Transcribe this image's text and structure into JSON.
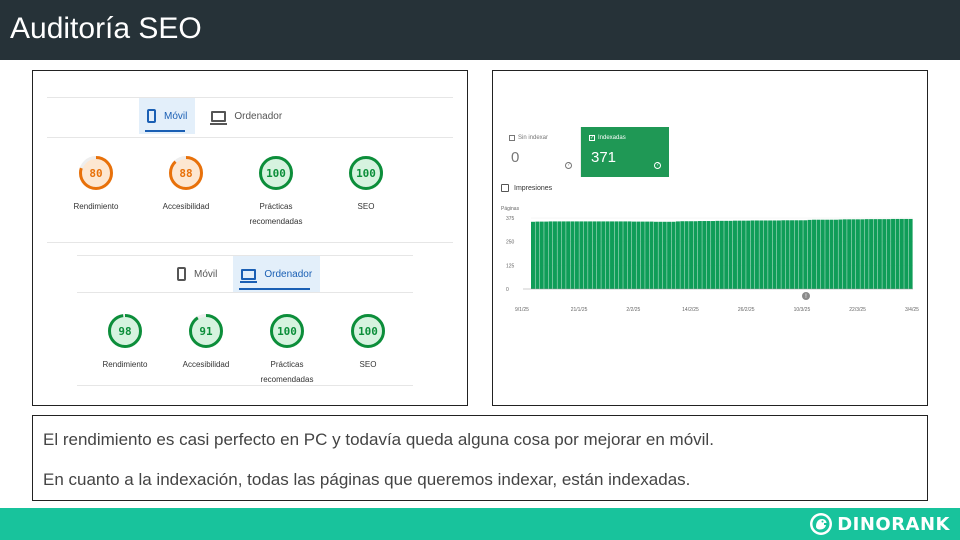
{
  "header": {
    "title": "Auditoría SEO"
  },
  "lighthouse_mobile": {
    "tabs": [
      {
        "label": "Móvil",
        "icon": "phone-icon",
        "active": true
      },
      {
        "label": "Ordenador",
        "icon": "laptop-icon",
        "active": false
      }
    ],
    "scores": [
      {
        "value": "80",
        "label": "Rendimiento",
        "score": 80,
        "color": "#e8710a",
        "track": "#fde7d1"
      },
      {
        "value": "88",
        "label": "Accesibilidad",
        "score": 88,
        "color": "#e8710a",
        "track": "#fde7d1"
      },
      {
        "value": "100",
        "label": "Prácticas recomendadas",
        "score": 100,
        "color": "#0c8e3a",
        "track": "#d6f3df"
      },
      {
        "value": "100",
        "label": "SEO",
        "score": 100,
        "color": "#0c8e3a",
        "track": "#d6f3df"
      }
    ]
  },
  "lighthouse_desktop": {
    "tabs": [
      {
        "label": "Móvil",
        "icon": "phone-icon",
        "active": false
      },
      {
        "label": "Ordenador",
        "icon": "laptop-icon",
        "active": true
      }
    ],
    "scores": [
      {
        "value": "98",
        "label": "Rendimiento",
        "score": 98,
        "color": "#0c8e3a",
        "track": "#d6f3df"
      },
      {
        "value": "91",
        "label": "Accesibilidad",
        "score": 91,
        "color": "#0c8e3a",
        "track": "#d6f3df"
      },
      {
        "value": "100",
        "label": "Prácticas recomendadas",
        "score": 100,
        "color": "#0c8e3a",
        "track": "#d6f3df"
      },
      {
        "value": "100",
        "label": "SEO",
        "score": 100,
        "color": "#0c8e3a",
        "track": "#d6f3df"
      }
    ]
  },
  "search_console": {
    "unindexed": {
      "label": "Sin indexar",
      "value": "0"
    },
    "indexed": {
      "label": "Indexadas",
      "value": "371",
      "color": "#1f9855"
    },
    "impressions_label": "Impresiones"
  },
  "chart_data": {
    "type": "bar",
    "ylabel": "Páginas",
    "yticks": [
      "375",
      "250",
      "125",
      "0"
    ],
    "ylim": [
      0,
      375
    ],
    "xticks": [
      "9/1/25",
      "21/1/25",
      "2/2/25",
      "14/2/25",
      "26/2/25",
      "10/3/25",
      "22/3/25",
      "3/4/25"
    ],
    "values": [
      355,
      356,
      356,
      356,
      357,
      357,
      357,
      357,
      357,
      357,
      357,
      357,
      357,
      357,
      357,
      357,
      357,
      357,
      357,
      357,
      357,
      357,
      357,
      356,
      356,
      356,
      356,
      356,
      355,
      355,
      355,
      355,
      355,
      357,
      358,
      358,
      358,
      358,
      359,
      359,
      359,
      359,
      360,
      360,
      360,
      360,
      361,
      361,
      361,
      361,
      362,
      362,
      362,
      362,
      362,
      362,
      362,
      363,
      363,
      363,
      363,
      363,
      363,
      365,
      366,
      366,
      366,
      366,
      366,
      366,
      367,
      368,
      368,
      368,
      368,
      368,
      369,
      369,
      369,
      369,
      369,
      369,
      370,
      370,
      370,
      370,
      370
    ],
    "color": "#0f9d58"
  },
  "notes": {
    "line1": "El rendimiento es casi perfecto en PC y todavía queda alguna cosa por mejorar en móvil.",
    "line2": "En cuanto a la indexación, todas las páginas que queremos indexar, están indexadas."
  },
  "footer": {
    "logo_text": "DINORANK"
  }
}
